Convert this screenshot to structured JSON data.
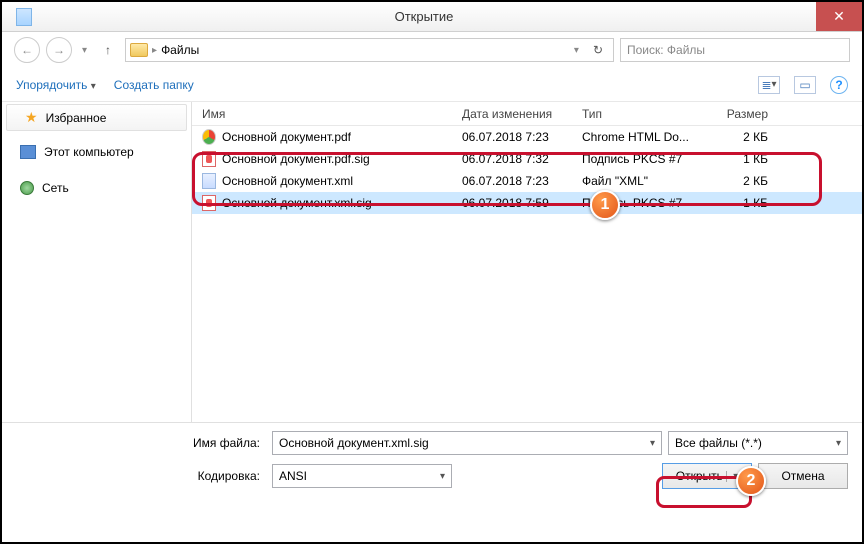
{
  "window": {
    "title": "Открытие"
  },
  "path": {
    "folder": "Файлы"
  },
  "search": {
    "placeholder": "Поиск: Файлы"
  },
  "toolbar": {
    "organize": "Упорядочить",
    "new_folder": "Создать папку"
  },
  "sidebar": {
    "favorites": "Избранное",
    "computer": "Этот компьютер",
    "network": "Сеть"
  },
  "columns": {
    "name": "Имя",
    "date": "Дата изменения",
    "type": "Тип",
    "size": "Размер"
  },
  "files": [
    {
      "name": "Основной документ.pdf",
      "date": "06.07.2018 7:23",
      "type": "Chrome HTML Do...",
      "size": "2 КБ",
      "icon": "chrome"
    },
    {
      "name": "Основной документ.pdf.sig",
      "date": "06.07.2018 7:32",
      "type": "Подпись PKCS #7",
      "size": "1 КБ",
      "icon": "sig"
    },
    {
      "name": "Основной документ.xml",
      "date": "06.07.2018 7:23",
      "type": "Файл \"XML\"",
      "size": "2 КБ",
      "icon": "xml"
    },
    {
      "name": "Основной документ.xml.sig",
      "date": "06.07.2018 7:59",
      "type": "Подпись PKCS #7",
      "size": "1 КБ",
      "icon": "sig"
    }
  ],
  "footer": {
    "filename_label": "Имя файла:",
    "filename_value": "Основной документ.xml.sig",
    "encoding_label": "Кодировка:",
    "encoding_value": "ANSI",
    "filter": "Все файлы (*.*)",
    "open": "Открыть",
    "cancel": "Отмена"
  },
  "badges": {
    "one": "1",
    "two": "2"
  }
}
